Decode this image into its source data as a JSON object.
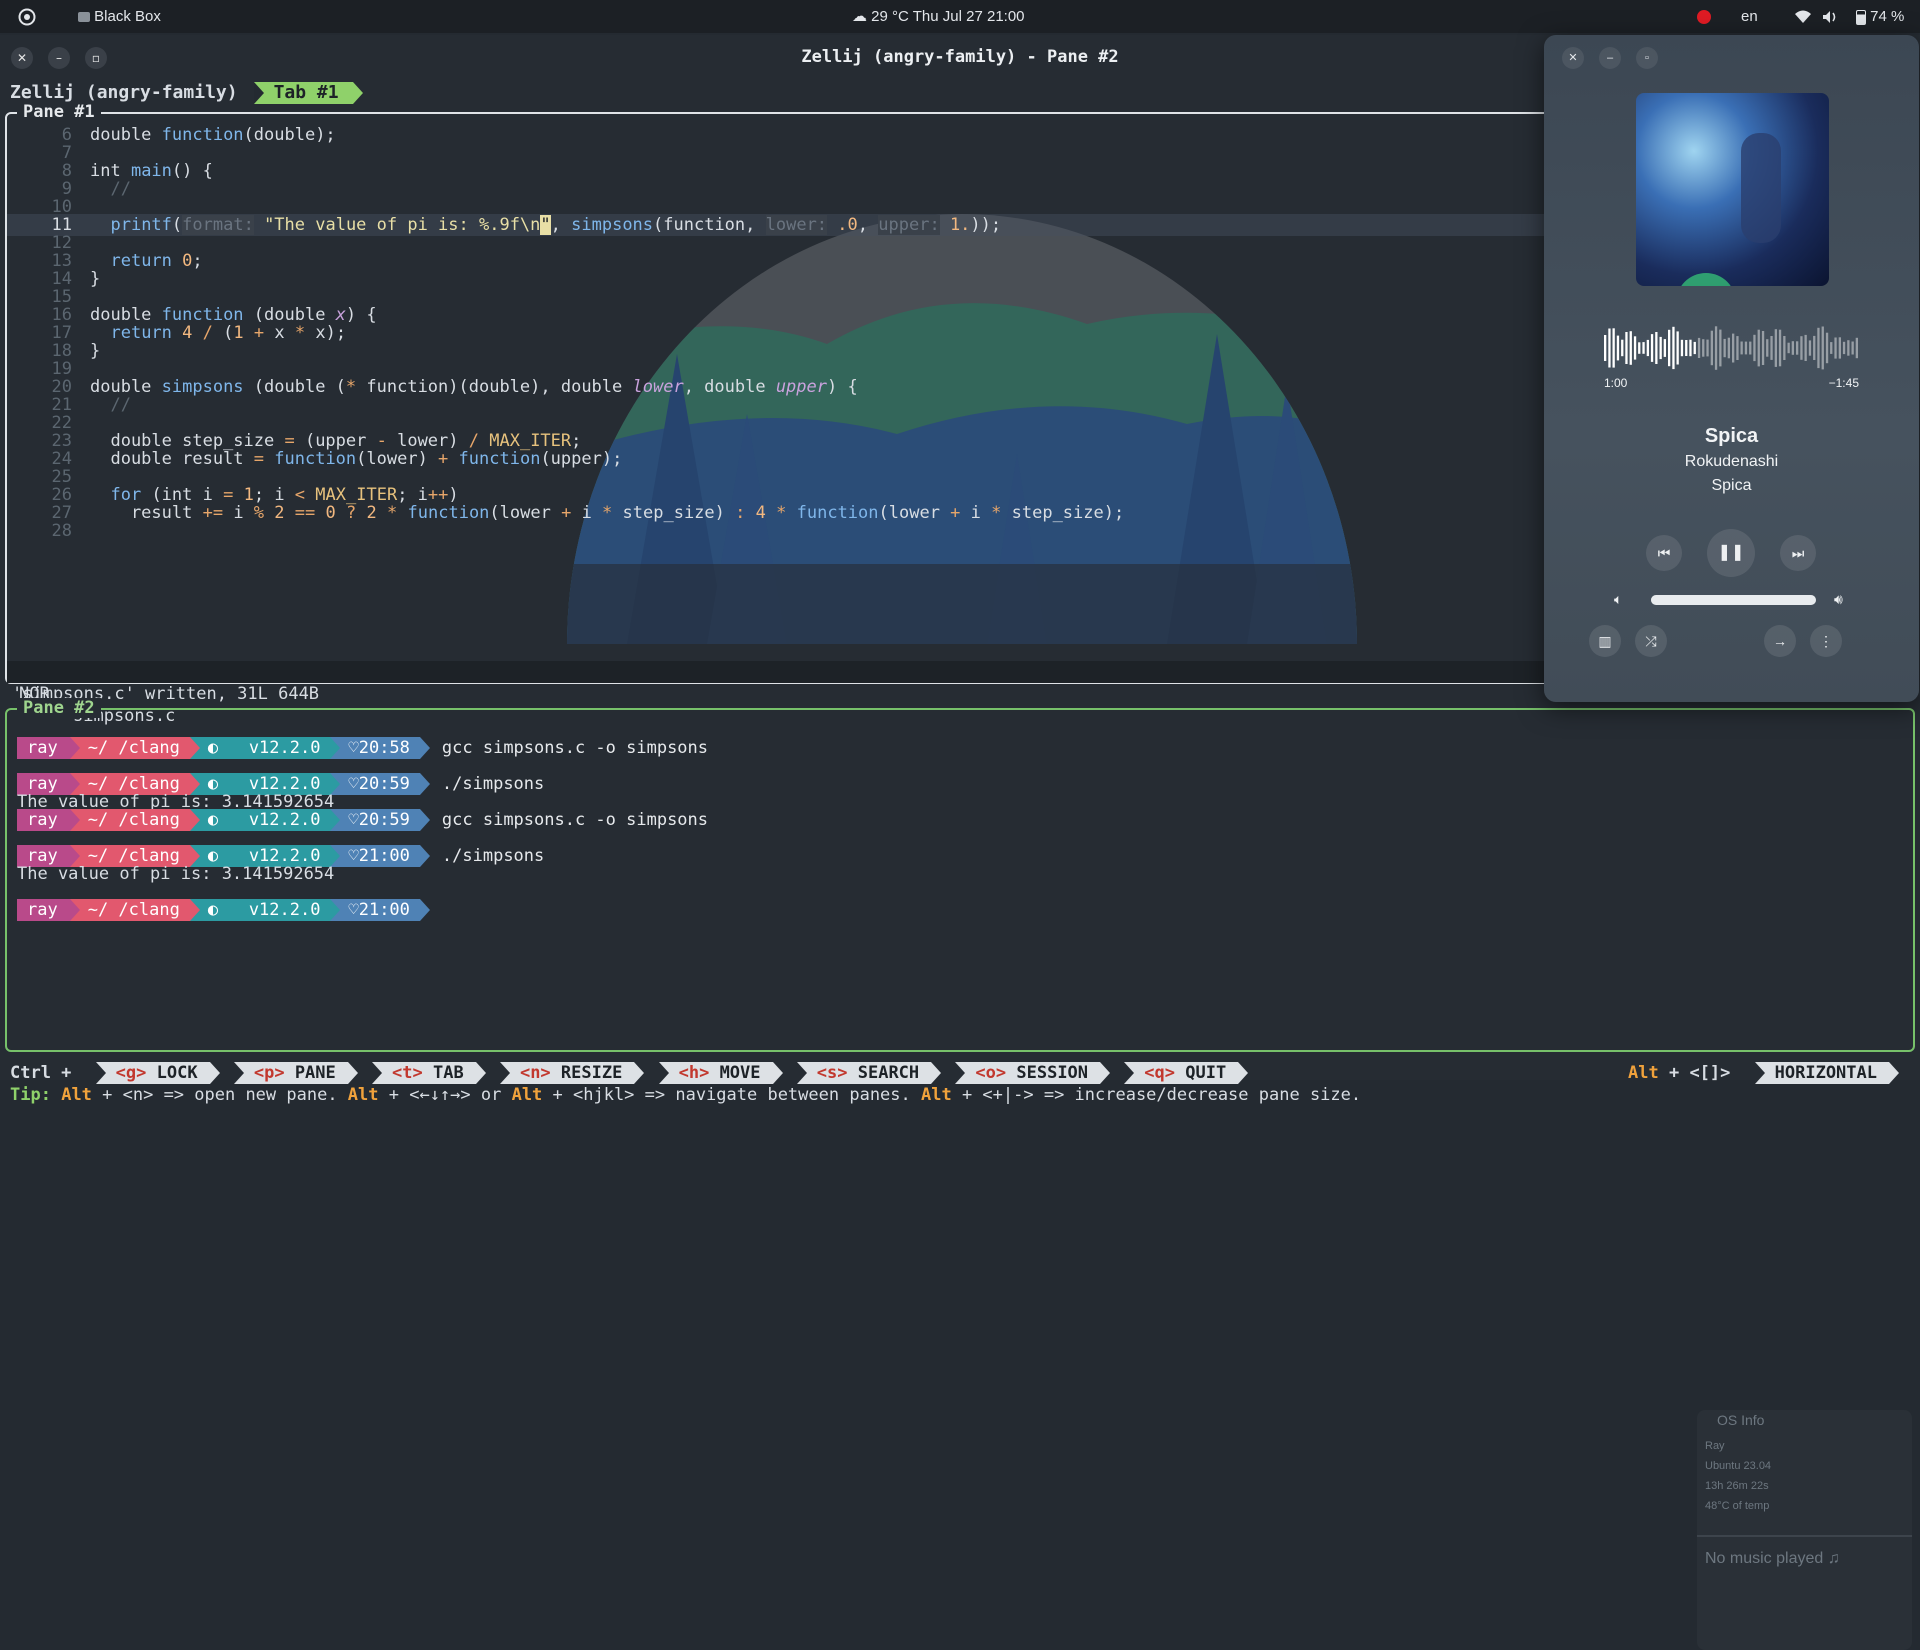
{
  "topbar": {
    "app_name": "Black Box",
    "weather": "29 °C",
    "clock": "Thu Jul 27  21:00",
    "input_lang": "en",
    "battery": "74 %"
  },
  "window": {
    "title": "Zellij (angry-family) - Pane #2"
  },
  "zellij": {
    "session_label": "Zellij (angry-family)",
    "tab_label": "Tab #1",
    "pane1_title": "Pane #1",
    "pane2_title": "Pane #2"
  },
  "editor": {
    "lines": [
      {
        "n": "6",
        "text": "double function(double);"
      },
      {
        "n": "7",
        "text": ""
      },
      {
        "n": "8",
        "text": "int main() {"
      },
      {
        "n": "9",
        "text": "  //"
      },
      {
        "n": "10",
        "text": ""
      },
      {
        "n": "11",
        "text": "  printf(format: \"The value of pi is: %.9f\\n\", simpsons(function, lower: .0, upper: 1.));"
      },
      {
        "n": "12",
        "text": ""
      },
      {
        "n": "13",
        "text": "  return 0;"
      },
      {
        "n": "14",
        "text": "}"
      },
      {
        "n": "15",
        "text": ""
      },
      {
        "n": "16",
        "text": "double function (double x) {"
      },
      {
        "n": "17",
        "text": "  return 4 / (1 + x * x);"
      },
      {
        "n": "18",
        "text": "}"
      },
      {
        "n": "19",
        "text": ""
      },
      {
        "n": "20",
        "text": "double simpsons (double (* function)(double), double lower, double upper) {"
      },
      {
        "n": "21",
        "text": "  //"
      },
      {
        "n": "22",
        "text": ""
      },
      {
        "n": "23",
        "text": "  double step_size = (upper - lower) / MAX_ITER;"
      },
      {
        "n": "24",
        "text": "  double result = function(lower) + function(upper);"
      },
      {
        "n": "25",
        "text": ""
      },
      {
        "n": "26",
        "text": "  for (int i = 1; i < MAX_ITER; i++)"
      },
      {
        "n": "27",
        "text": "    result += i % 2 == 0 ? 2 * function(lower + i * step_size) : 4 * function(lower + i * step_size);"
      },
      {
        "n": "28",
        "text": ""
      }
    ],
    "mode": "NOR",
    "filename": "simpsons.c",
    "message": "'simpsons.c' written, 31L 644B"
  },
  "shell": {
    "prompt_user": "ray",
    "prompt_path": "~/  /clang",
    "prompt_version": "v12.2.0",
    "entries": [
      {
        "time": "20:58",
        "command": "gcc simpsons.c -o simpsons",
        "output": ""
      },
      {
        "time": "20:59",
        "command": "./simpsons",
        "output": "The value of pi is: 3.141592654"
      },
      {
        "time": "20:59",
        "command": "gcc simpsons.c -o simpsons",
        "output": ""
      },
      {
        "time": "21:00",
        "command": "./simpsons",
        "output": "The value of pi is: 3.141592654"
      },
      {
        "time": "21:00",
        "command": "",
        "output": ""
      }
    ]
  },
  "os_info": {
    "title": "OS Info",
    "user": "Ray",
    "os": "Ubuntu 23.04",
    "uptime": "13h 26m 22s",
    "temp": "48°C of temp",
    "music_status": "No music played"
  },
  "player": {
    "elapsed": "1:00",
    "remaining": "−1:45",
    "track": "Spica",
    "artist": "Rokudenashi",
    "album": "Spica",
    "progress": 0.36,
    "volume": 1.0
  },
  "keybar": {
    "ctrl_label": "Ctrl +",
    "keys": [
      {
        "key": "<g>",
        "label": "LOCK"
      },
      {
        "key": "<p>",
        "label": "PANE"
      },
      {
        "key": "<t>",
        "label": "TAB"
      },
      {
        "key": "<n>",
        "label": "RESIZE"
      },
      {
        "key": "<h>",
        "label": "MOVE"
      },
      {
        "key": "<s>",
        "label": "SEARCH"
      },
      {
        "key": "<o>",
        "label": "SESSION"
      },
      {
        "key": "<q>",
        "label": "QUIT"
      }
    ],
    "alt_label": "Alt",
    "alt_keys": "+ <[]>",
    "layout_mode": "HORIZONTAL"
  },
  "tip": {
    "prefix": "Tip:",
    "alt": "Alt",
    "part1": " + <n> => open new pane. ",
    "part2": " + <←↓↑→> or ",
    "part3": " + <hjkl> => navigate between panes. ",
    "part4": " + <+|-> => increase/decrease pane size."
  },
  "colors": {
    "tab_active": "#8fd16a",
    "pane2_border": "#77c16a",
    "prompt_user": "#b94a8a",
    "prompt_path": "#e2586e",
    "prompt_git": "#2c9ba2",
    "prompt_time": "#4f82b5"
  }
}
